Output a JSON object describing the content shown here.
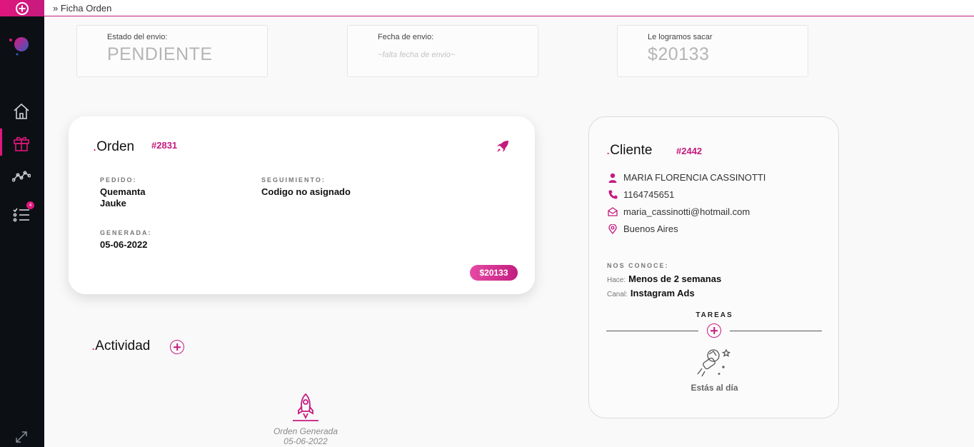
{
  "topbar": {
    "breadcrumb": "» Ficha Orden"
  },
  "stats": [
    {
      "label": "Estado del envio:",
      "value": "PENDIENTE"
    },
    {
      "label": "Fecha de envio:",
      "value": "~falta fecha de envio~"
    },
    {
      "label": "Le logramos sacar",
      "value": "$20133"
    }
  ],
  "order": {
    "title_dot": ".",
    "title": "Orden",
    "id": "#2831",
    "pedido_label": "PEDIDO:",
    "pedido_value_line1": "Quemanta",
    "pedido_value_line2": "Jauke",
    "seguimiento_label": "SEGUIMIENTO:",
    "seguimiento_value": "Codigo no asignado",
    "generada_label": "GENERADA:",
    "generada_value": "05-06-2022",
    "price": "$20133"
  },
  "client": {
    "title_dot": ".",
    "title": "Cliente",
    "id": "#2442",
    "name": "MARIA FLORENCIA CASSINOTTI",
    "phone": "1164745651",
    "email": "maria_cassinotti@hotmail.com",
    "location": "Buenos Aires",
    "nos_conoce_label": "NOS CONOCE:",
    "hace_key": "Hace:",
    "hace_value": "Menos de 2 semanas",
    "canal_key": "Canal:",
    "canal_value": "Instagram Ads",
    "tareas_label": "TAREAS",
    "up_to_date": "Estás al día"
  },
  "activity": {
    "title_dot": ".",
    "title": "Actividad",
    "event_label": "Orden Generada",
    "event_date": "05-06-2022"
  },
  "colors": {
    "accent": "#c61a7e",
    "sidebar": "#0c1014"
  }
}
